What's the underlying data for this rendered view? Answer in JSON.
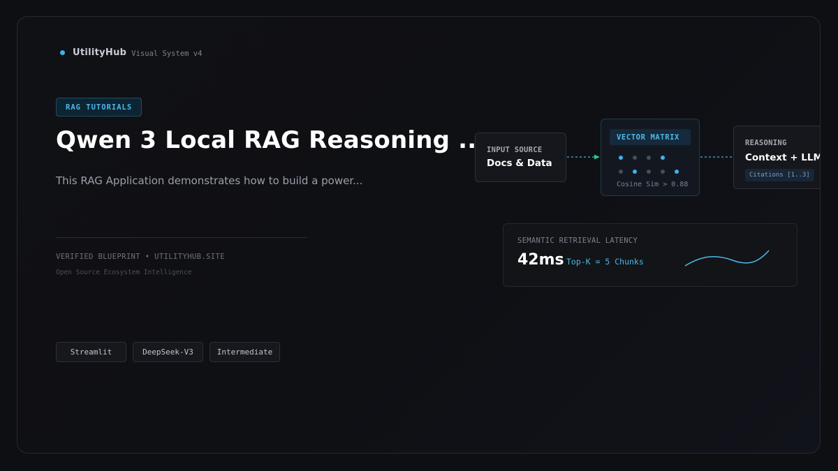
{
  "brand": {
    "name": "UtilityHub",
    "subtitle": "Visual System v4",
    "dot_color": "#3fb2f0"
  },
  "tag": {
    "label": "RAG TUTORIALS"
  },
  "hero": {
    "title": "Qwen 3 Local RAG Reasoning ...",
    "description": "This RAG Application demonstrates how to build a power..."
  },
  "footer": {
    "verified": "VERIFIED BLUEPRINT • UTILITYHUB.SITE",
    "tagline": "Open Source Ecosystem Intelligence"
  },
  "chips": [
    "Streamlit",
    "DeepSeek-V3",
    "Intermediate"
  ],
  "pipeline": {
    "input": {
      "label": "INPUT SOURCE",
      "value": "Docs & Data"
    },
    "vector": {
      "label": "VECTOR MATRIX",
      "note": "Cosine Sim > 0.88",
      "dot_rows": [
        [
          "active",
          "dim",
          "dim",
          "active"
        ],
        [
          "dim",
          "active",
          "dim",
          "dim",
          "active"
        ]
      ]
    },
    "reasoning": {
      "label": "REASONING",
      "value": "Context + LLM",
      "badge": "Citations [1..3]"
    },
    "connector_color": "#3fb2f0",
    "arrow_color": "#2fc28a"
  },
  "latency": {
    "label": "SEMANTIC RETRIEVAL LATENCY",
    "value": "42ms",
    "detail": "Top-K = 5 Chunks",
    "accent": "#4fb8e8"
  },
  "colors": {
    "accent": "#4fb8e8",
    "background": "#0e0f13",
    "active_dot": "#3fb2f0",
    "dim_dot": "#4a4d56"
  }
}
